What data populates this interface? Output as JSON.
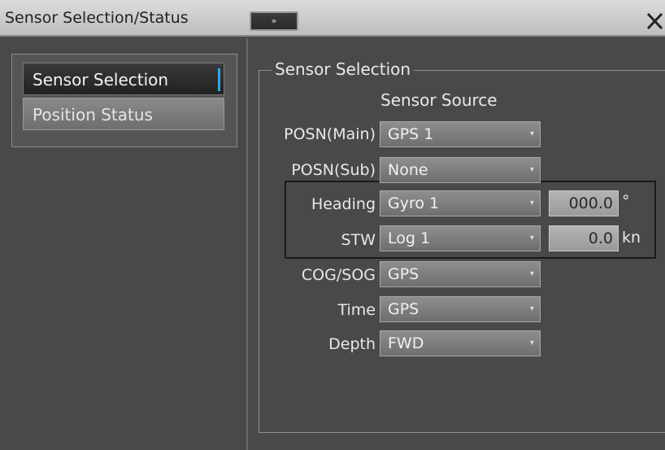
{
  "window": {
    "title": "Sensor Selection/Status",
    "expand_label": "»",
    "close_label": "X"
  },
  "nav": {
    "items": [
      {
        "label": "Sensor Selection",
        "active": true
      },
      {
        "label": "Position Status",
        "active": false
      }
    ]
  },
  "panel": {
    "group_title": "Sensor Selection",
    "column_header": "Sensor Source",
    "rows": {
      "posn_main": {
        "label": "POSN(Main)",
        "value": "GPS 1"
      },
      "posn_sub": {
        "label": "POSN(Sub)",
        "value": "None"
      },
      "heading": {
        "label": "Heading",
        "value": "Gyro 1",
        "readout": "000.0",
        "unit": "°"
      },
      "stw": {
        "label": "STW",
        "value": "Log 1",
        "readout": "0.0",
        "unit": "kn"
      },
      "cog_sog": {
        "label": "COG/SOG",
        "value": "GPS"
      },
      "time": {
        "label": "Time",
        "value": "GPS"
      },
      "depth": {
        "label": "Depth",
        "value": "FWD"
      }
    }
  }
}
